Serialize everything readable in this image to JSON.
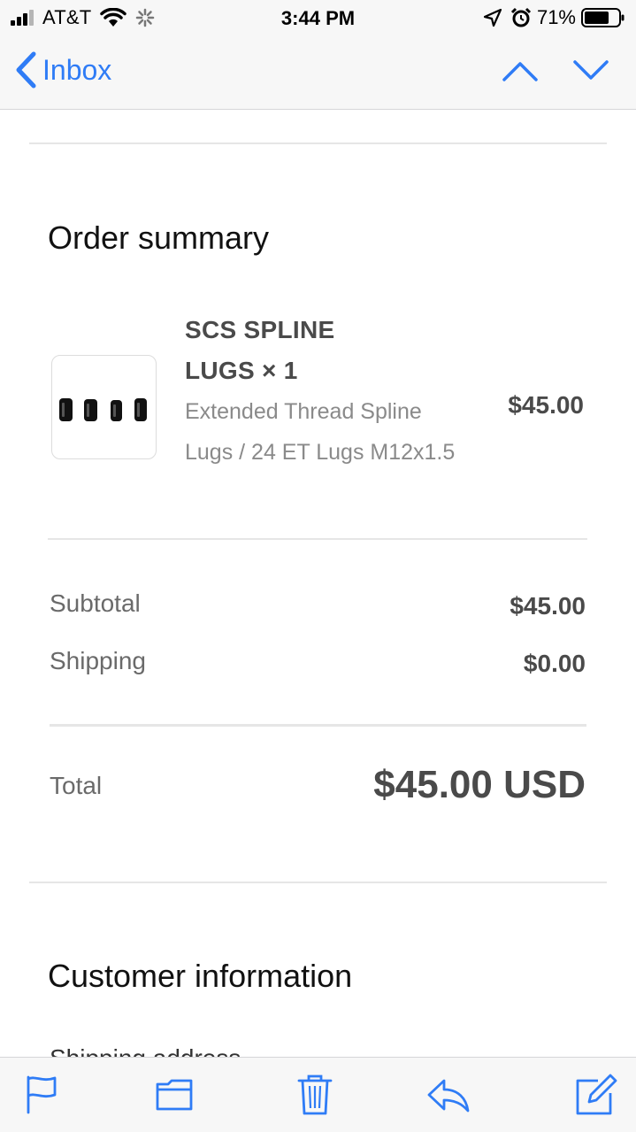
{
  "status_bar": {
    "carrier": "AT&T",
    "time": "3:44 PM",
    "battery_percent": "71%"
  },
  "nav": {
    "back_label": "Inbox"
  },
  "order_summary": {
    "title": "Order summary",
    "item": {
      "name": "SCS SPLINE LUGS × 1",
      "variant": "Extended Thread Spline Lugs / 24 ET Lugs M12x1.5",
      "price": "$45.00"
    },
    "subtotal_label": "Subtotal",
    "subtotal_value": "$45.00",
    "shipping_label": "Shipping",
    "shipping_value": "$0.00",
    "total_label": "Total",
    "total_value": "$45.00 USD"
  },
  "customer_information": {
    "title": "Customer information",
    "shipping_address_label": "Shipping address"
  },
  "colors": {
    "accent": "#2f7cf6",
    "text_dark": "#4a4a4a",
    "text_muted": "#8a8a8a"
  },
  "toolbar": {
    "icons": [
      "flag-icon",
      "folder-icon",
      "trash-icon",
      "reply-icon",
      "compose-icon"
    ]
  }
}
